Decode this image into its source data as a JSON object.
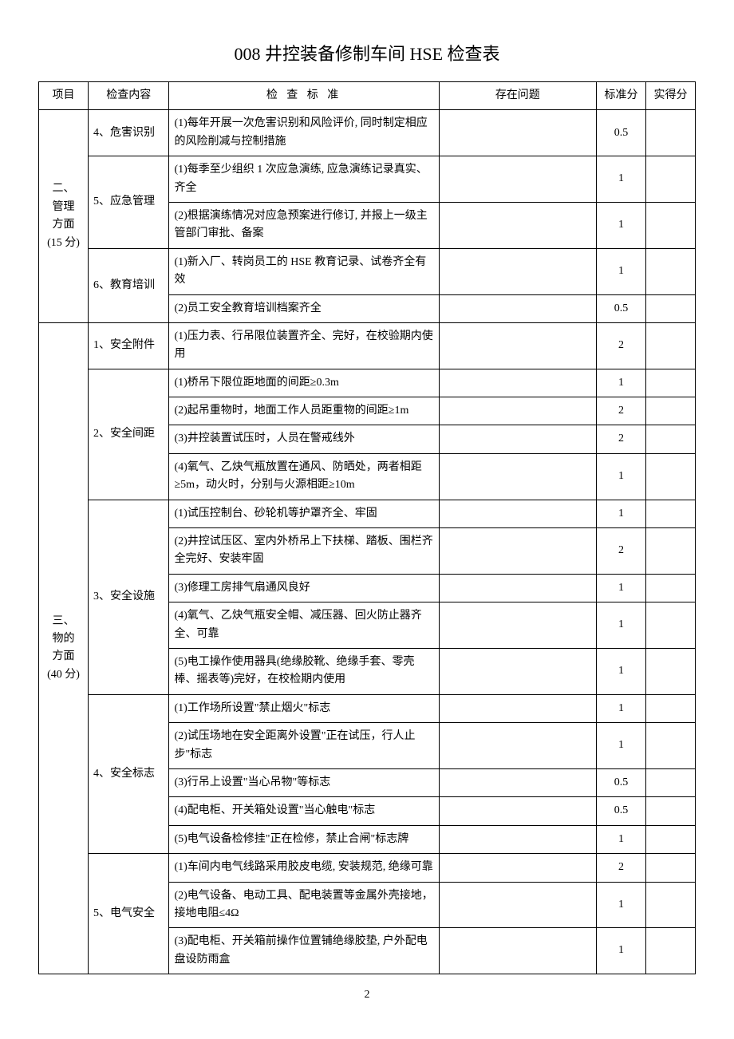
{
  "title": "008 井控装备修制车间 HSE 检查表",
  "page_number": "2",
  "headers": {
    "project": "项目",
    "content": "检查内容",
    "standard": "检 查 标 准",
    "issues": "存在问题",
    "std_score": "标准分",
    "got_score": "实得分"
  },
  "sections": [
    {
      "project": "二、\n管理\n方面\n(15 分)",
      "items": [
        {
          "content": "4、危害识别",
          "standards": [
            {
              "text": "(1)每年开展一次危害识别和风险评价, 同时制定相应的风险削减与控制措施",
              "std": "0.5"
            }
          ]
        },
        {
          "content": "5、应急管理",
          "standards": [
            {
              "text": "(1)每季至少组织 1 次应急演练, 应急演练记录真实、齐全",
              "std": "1"
            },
            {
              "text": "(2)根据演练情况对应急预案进行修订, 并报上一级主管部门审批、备案",
              "std": "1"
            }
          ]
        },
        {
          "content": "6、教育培训",
          "standards": [
            {
              "text": "(1)新入厂、转岗员工的 HSE 教育记录、试卷齐全有效",
              "std": "1"
            },
            {
              "text": "(2)员工安全教育培训档案齐全",
              "std": "0.5"
            }
          ]
        }
      ]
    },
    {
      "project": "三、\n物的\n方面\n(40 分)",
      "items": [
        {
          "content": "1、安全附件",
          "standards": [
            {
              "text": "(1)压力表、行吊限位装置齐全、完好，在校验期内使用",
              "std": "2"
            }
          ]
        },
        {
          "content": "2、安全间距",
          "standards": [
            {
              "text": "(1)桥吊下限位距地面的间距≥0.3m",
              "std": "1"
            },
            {
              "text": "(2)起吊重物时，地面工作人员距重物的间距≥1m",
              "std": "2"
            },
            {
              "text": "(3)井控装置试压时，人员在警戒线外",
              "std": "2"
            },
            {
              "text": "(4)氧气、乙炔气瓶放置在通风、防晒处，两者相距≥5m，动火时，分别与火源相距≥10m",
              "std": "1"
            }
          ]
        },
        {
          "content": "3、安全设施",
          "standards": [
            {
              "text": "(1)试压控制台、砂轮机等护罩齐全、牢固",
              "std": "1"
            },
            {
              "text": "(2)井控试压区、室内外桥吊上下扶梯、踏板、围栏齐全完好、安装牢固",
              "std": "2"
            },
            {
              "text": "(3)修理工房排气扇通风良好",
              "std": "1"
            },
            {
              "text": "(4)氧气、乙炔气瓶安全帽、减压器、回火防止器齐全、可靠",
              "std": "1"
            },
            {
              "text": "(5)电工操作使用器具(绝缘胶靴、绝缘手套、零壳棒、摇表等)完好，在校检期内使用",
              "std": "1"
            }
          ]
        },
        {
          "content": "4、安全标志",
          "standards": [
            {
              "text": "(1)工作场所设置\"禁止烟火\"标志",
              "std": "1"
            },
            {
              "text": "(2)试压场地在安全距离外设置\"正在试压，行人止步\"标志",
              "std": "1"
            },
            {
              "text": "(3)行吊上设置\"当心吊物\"等标志",
              "std": "0.5"
            },
            {
              "text": "(4)配电柜、开关箱处设置\"当心触电\"标志",
              "std": "0.5"
            },
            {
              "text": "(5)电气设备检修挂\"正在检修，禁止合闸\"标志牌",
              "std": "1"
            }
          ]
        },
        {
          "content": "5、电气安全",
          "standards": [
            {
              "text": "(1)车间内电气线路采用胶皮电缆, 安装规范, 绝缘可靠",
              "std": "2"
            },
            {
              "text": "(2)电气设备、电动工具、配电装置等金属外壳接地，接地电阻≤4Ω",
              "std": "1"
            },
            {
              "text": "(3)配电柜、开关箱前操作位置铺绝缘胶垫, 户外配电盘设防雨盒",
              "std": "1"
            }
          ]
        }
      ]
    }
  ]
}
